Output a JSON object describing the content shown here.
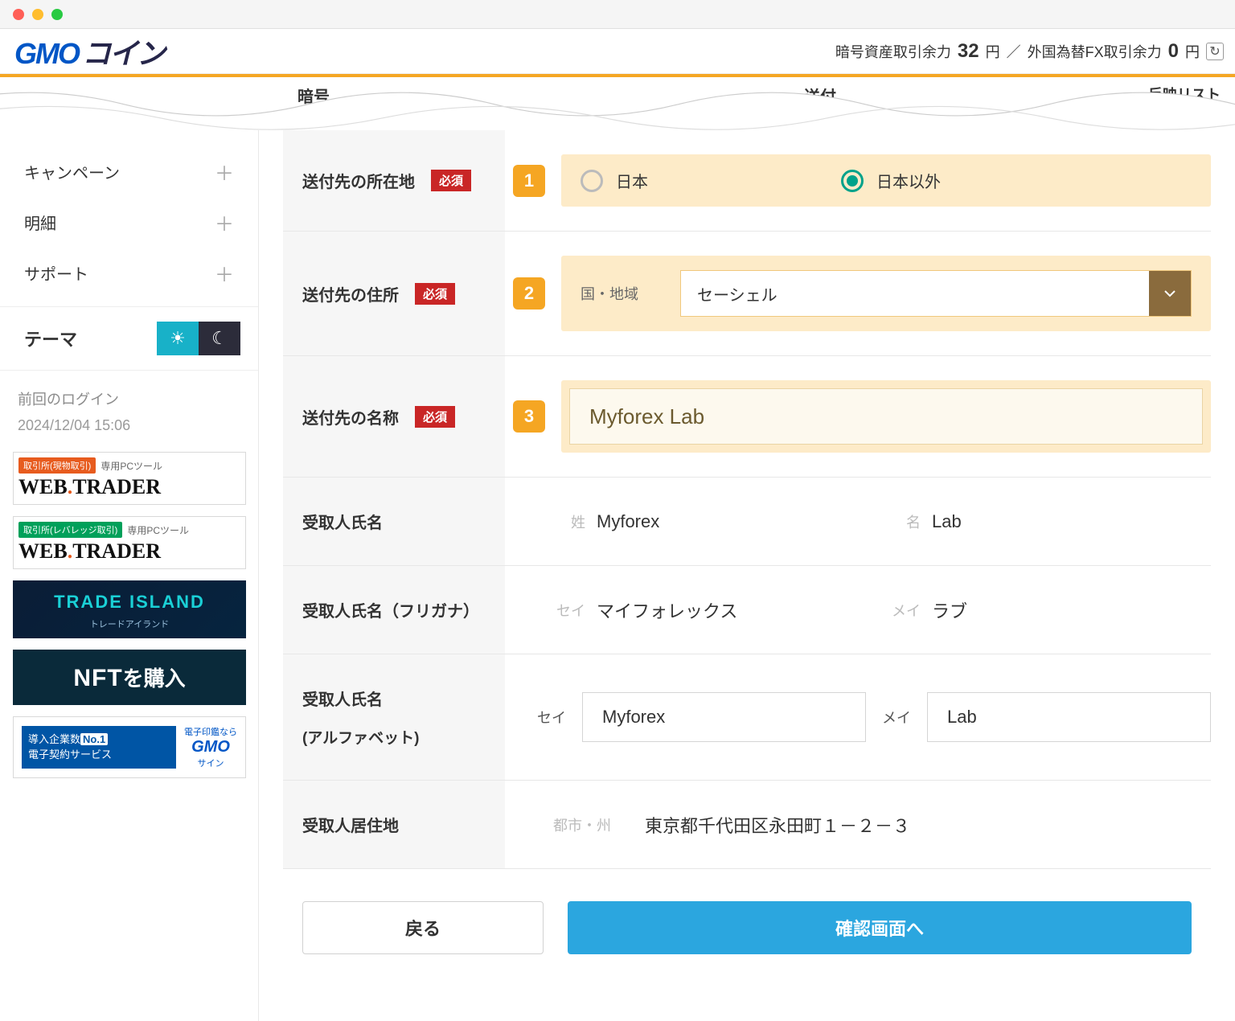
{
  "header": {
    "logo_gmo": "GMO",
    "logo_coin": "コイン",
    "balance_crypto_label": "暗号資産取引余力",
    "balance_crypto_value": "32",
    "balance_crypto_unit": "円",
    "divider": "／",
    "balance_fx_label": "外国為替FX取引余力",
    "balance_fx_value": "0",
    "balance_fx_unit": "円"
  },
  "wavy": {
    "text1": "暗号",
    "text2": "送付",
    "text3": "反映リスト"
  },
  "sidebar": {
    "items": [
      {
        "label": "キャンペーン"
      },
      {
        "label": "明細"
      },
      {
        "label": "サポート"
      }
    ],
    "theme_label": "テーマ",
    "last_login_label": "前回のログイン",
    "last_login_time": "2024/12/04 15:06",
    "promos": {
      "wt1_tag": "取引所(現物取引)",
      "wt1_sub": "専用PCツール",
      "wt1_big_a": "WEB",
      "wt1_big_b": "TRADER",
      "wt2_tag": "取引所(レバレッジ取引)",
      "wt2_sub": "専用PCツール",
      "ti_label_a": "TRADE ",
      "ti_label_b": "ISLAND",
      "ti_sub": "トレードアイランド",
      "nft_a": "NFT",
      "nft_b": "を購入",
      "gs_left_a": "導入企業数",
      "gs_left_b": "No.1",
      "gs_left_c": "電子契約サービス",
      "gs_right_top": "電子印鑑なら",
      "gs_right_logo": "GMO",
      "gs_right_sub": "サイン"
    }
  },
  "form": {
    "required": "必須",
    "row1": {
      "label": "送付先の所在地",
      "option_japan": "日本",
      "option_other": "日本以外"
    },
    "row2": {
      "label": "送付先の住所",
      "sublabel": "国・地域",
      "value": "セーシェル"
    },
    "row3": {
      "label": "送付先の名称",
      "value": "Myforex Lab"
    },
    "row4": {
      "label": "受取人氏名",
      "sei_label": "姓",
      "sei_value": "Myforex",
      "mei_label": "名",
      "mei_value": "Lab"
    },
    "row5": {
      "label": "受取人氏名（フリガナ）",
      "sei_label": "セイ",
      "sei_value": "マイフォレックス",
      "mei_label": "メイ",
      "mei_value": "ラブ"
    },
    "row6": {
      "label_a": "受取人氏名",
      "label_b": "(アルファベット)",
      "sei_label": "セイ",
      "sei_value": "Myforex",
      "mei_label": "メイ",
      "mei_value": "Lab"
    },
    "row7": {
      "label": "受取人居住地",
      "sublabel": "都市・州",
      "value": "東京都千代田区永田町１－２－３"
    },
    "btn_back": "戻る",
    "btn_confirm": "確認画面へ"
  }
}
